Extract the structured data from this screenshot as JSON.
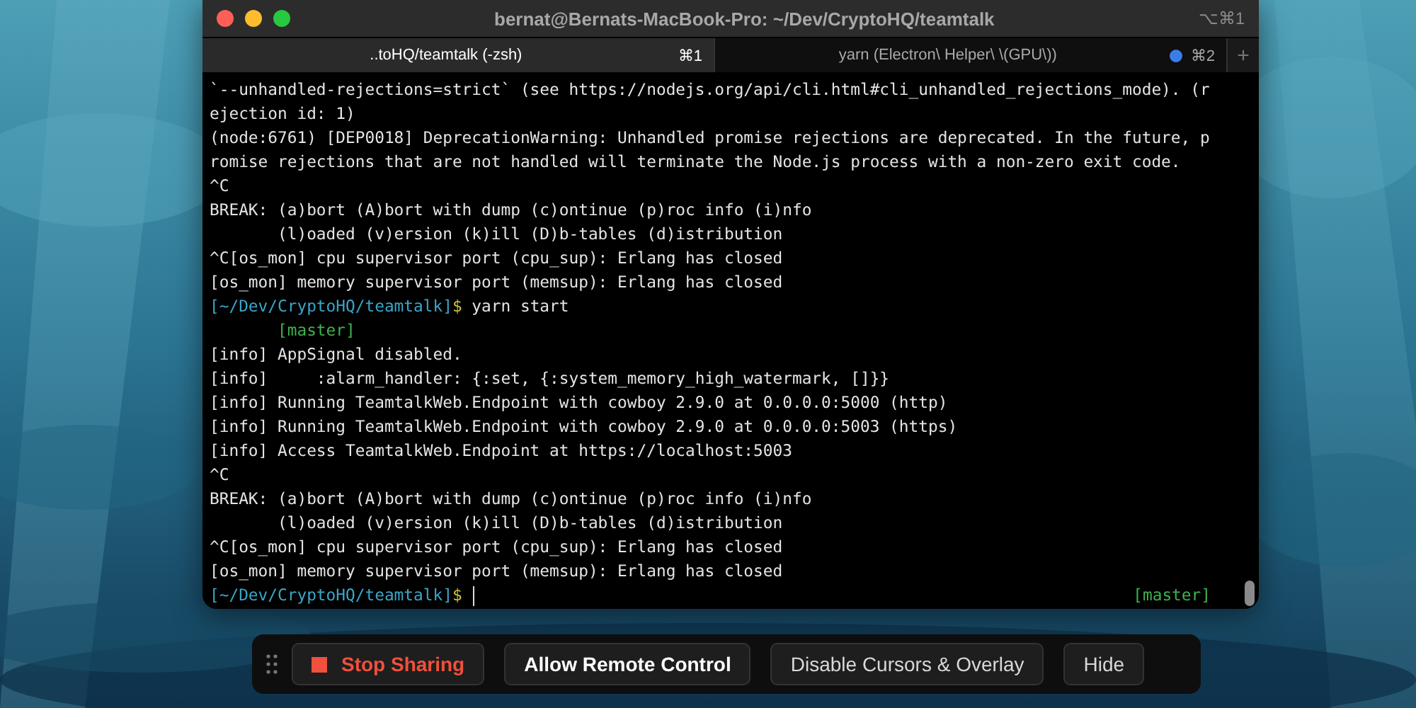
{
  "window": {
    "title": "bernat@Bernats-MacBook-Pro: ~/Dev/CryptoHQ/teamtalk",
    "shortcut": "⌥⌘1"
  },
  "tabs": [
    {
      "label": "..toHQ/teamtalk (-zsh)",
      "shortcut": "⌘1",
      "selected": true,
      "activity": false
    },
    {
      "label": "yarn (Electron\\ Helper\\ \\(GPU\\))",
      "shortcut": "⌘2",
      "selected": false,
      "activity": true
    }
  ],
  "new_tab_button": "+",
  "terminal": {
    "lines": [
      {
        "segments": [
          {
            "kind": "plain",
            "text": "`--unhandled-rejections=strict` (see https://nodejs.org/api/cli.html#cli_unhandled_rejections_mode). (r"
          }
        ]
      },
      {
        "segments": [
          {
            "kind": "plain",
            "text": "ejection id: 1)"
          }
        ]
      },
      {
        "segments": [
          {
            "kind": "plain",
            "text": "(node:6761) [DEP0018] DeprecationWarning: Unhandled promise rejections are deprecated. In the future, p"
          }
        ]
      },
      {
        "segments": [
          {
            "kind": "plain",
            "text": "romise rejections that are not handled will terminate the Node.js process with a non-zero exit code."
          }
        ]
      },
      {
        "segments": [
          {
            "kind": "plain",
            "text": "^C"
          }
        ]
      },
      {
        "segments": [
          {
            "kind": "plain",
            "text": "BREAK: (a)bort (A)bort with dump (c)ontinue (p)roc info (i)nfo"
          }
        ]
      },
      {
        "segments": [
          {
            "kind": "plain",
            "text": "       (l)oaded (v)ersion (k)ill (D)b-tables (d)istribution"
          }
        ]
      },
      {
        "segments": [
          {
            "kind": "plain",
            "text": "^C[os_mon] cpu supervisor port (cpu_sup): Erlang has closed"
          }
        ]
      },
      {
        "segments": [
          {
            "kind": "plain",
            "text": "[os_mon] memory supervisor port (memsup): Erlang has closed"
          }
        ]
      },
      {
        "segments": [
          {
            "kind": "prompt",
            "text": "[~/Dev/CryptoHQ/teamtalk]"
          },
          {
            "kind": "dollar",
            "text": "$"
          },
          {
            "kind": "plain",
            "text": " yarn start"
          }
        ]
      },
      {
        "segments": [
          {
            "kind": "branch",
            "text": "       [master]"
          }
        ]
      },
      {
        "segments": [
          {
            "kind": "plain",
            "text": "[info] AppSignal disabled."
          }
        ]
      },
      {
        "segments": [
          {
            "kind": "plain",
            "text": "[info]     :alarm_handler: {:set, {:system_memory_high_watermark, []}}"
          }
        ]
      },
      {
        "segments": [
          {
            "kind": "plain",
            "text": "[info] Running TeamtalkWeb.Endpoint with cowboy 2.9.0 at 0.0.0.0:5000 (http)"
          }
        ]
      },
      {
        "segments": [
          {
            "kind": "plain",
            "text": "[info] Running TeamtalkWeb.Endpoint with cowboy 2.9.0 at 0.0.0.0:5003 (https)"
          }
        ]
      },
      {
        "segments": [
          {
            "kind": "plain",
            "text": "[info] Access TeamtalkWeb.Endpoint at https://localhost:5003"
          }
        ]
      },
      {
        "segments": [
          {
            "kind": "plain",
            "text": "^C"
          }
        ]
      },
      {
        "segments": [
          {
            "kind": "plain",
            "text": "BREAK: (a)bort (A)bort with dump (c)ontinue (p)roc info (i)nfo"
          }
        ]
      },
      {
        "segments": [
          {
            "kind": "plain",
            "text": "       (l)oaded (v)ersion (k)ill (D)b-tables (d)istribution"
          }
        ]
      },
      {
        "segments": [
          {
            "kind": "plain",
            "text": "^C[os_mon] cpu supervisor port (cpu_sup): Erlang has closed"
          }
        ]
      },
      {
        "segments": [
          {
            "kind": "plain",
            "text": "[os_mon] memory supervisor port (memsup): Erlang has closed"
          }
        ]
      },
      {
        "segments": [
          {
            "kind": "prompt",
            "text": "[~/Dev/CryptoHQ/teamtalk]"
          },
          {
            "kind": "dollar",
            "text": "$"
          }
        ],
        "cursor": true,
        "right": "[master]"
      }
    ]
  },
  "share_bar": {
    "buttons": [
      {
        "kind": "stop",
        "label": "Stop Sharing"
      },
      {
        "kind": "primary",
        "label": "Allow Remote Control"
      },
      {
        "kind": "normal",
        "label": "Disable Cursors & Overlay"
      },
      {
        "kind": "normal",
        "label": "Hide"
      }
    ]
  }
}
